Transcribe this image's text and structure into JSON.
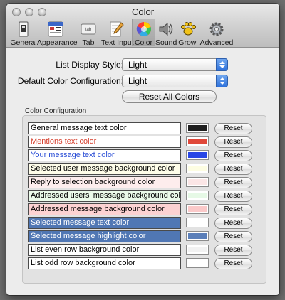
{
  "window": {
    "title": "Color"
  },
  "toolbar": [
    {
      "label": "General",
      "icon": "switch-icon"
    },
    {
      "label": "Appearance",
      "icon": "file-new-icon"
    },
    {
      "label": "Tab",
      "icon": "tab-key-icon"
    },
    {
      "label": "Text Input",
      "icon": "pencil-icon"
    },
    {
      "label": "Color",
      "icon": "color-wheel-icon",
      "selected": true
    },
    {
      "label": "Sound",
      "icon": "speaker-icon"
    },
    {
      "label": "Growl",
      "icon": "growl-paw-icon"
    },
    {
      "label": "Advanced",
      "icon": "gear-icon"
    }
  ],
  "form": {
    "list_display_label": "List Display Style:",
    "list_display_value": "Light",
    "default_color_label": "Default Color Configuration:",
    "default_color_value": "Light",
    "reset_all_label": "Reset All Colors"
  },
  "group_title": "Color Configuration",
  "reset_label": "Reset",
  "rows": [
    {
      "label": "General message text color",
      "text_color": "#000000",
      "bg": "#ffffff",
      "swatch": "#1e1e1e"
    },
    {
      "label": "Mentions text color",
      "text_color": "#d6412f",
      "bg": "#ffffff",
      "swatch": "#e0483a"
    },
    {
      "label": "Your message text color",
      "text_color": "#2c4fd6",
      "bg": "#ffffff",
      "swatch": "#2846e6"
    },
    {
      "label": "Selected user message background color",
      "text_color": "#000000",
      "bg": "#fefde9",
      "swatch": "#fdfde2"
    },
    {
      "label": "Reply to selection background color",
      "text_color": "#000000",
      "bg": "#fdeded",
      "swatch": "#fbe6e6"
    },
    {
      "label": "Addressed users' message background color",
      "text_color": "#000000",
      "bg": "#ebfaea",
      "swatch": "#e6f9e6"
    },
    {
      "label": "Addressed message background color",
      "text_color": "#000000",
      "bg": "#fcd2d2",
      "swatch": "#fbc9c9"
    },
    {
      "label": "Selected message text color",
      "text_color": "#ffffff",
      "bg": "#5077b4",
      "swatch": "#ffffff"
    },
    {
      "label": "Selected message highlight color",
      "text_color": "#ffffff",
      "bg": "#5077b4",
      "swatch": "#5b7fb9"
    },
    {
      "label": "List even row background color",
      "text_color": "#000000",
      "bg": "#ffffff",
      "swatch": "#f2f2f2"
    },
    {
      "label": "List odd row background color",
      "text_color": "#000000",
      "bg": "#ffffff",
      "swatch": "#ffffff"
    }
  ]
}
